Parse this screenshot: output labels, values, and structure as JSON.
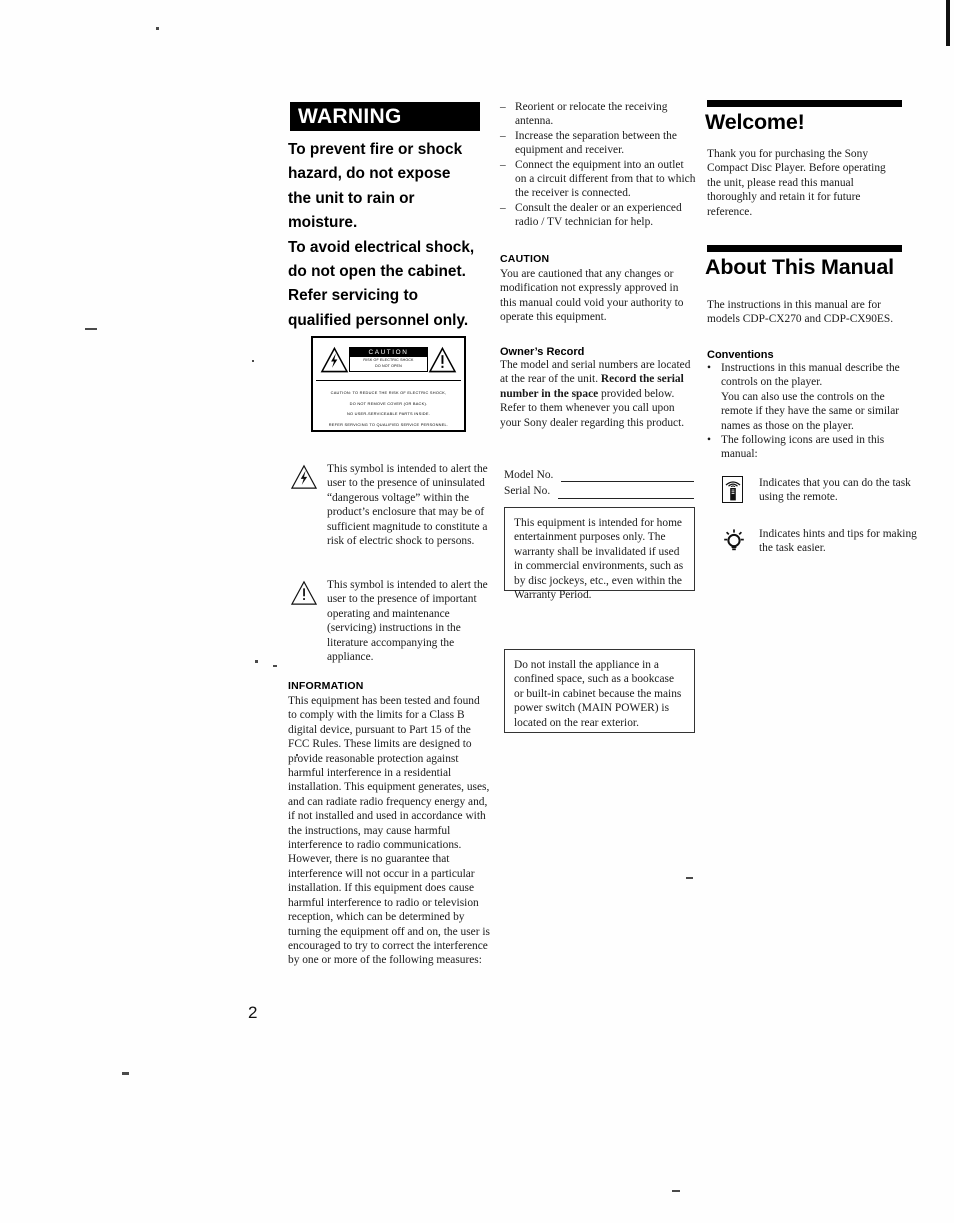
{
  "document": {
    "page_number": "2",
    "language": "en"
  },
  "column1": {
    "warning": {
      "title": "WARNING",
      "lines": [
        "To prevent fire or shock",
        "hazard, do not expose",
        "the unit to rain or",
        "moisture.",
        "To avoid electrical shock,",
        "do not open the cabinet.",
        "Refer servicing to",
        "qualified personnel only."
      ]
    },
    "label_graphic": {
      "caution_word": "CAUTION",
      "caution_sub_line1": "RISK OF ELECTRIC SHOCK",
      "caution_sub_line2": "DO NOT OPEN",
      "bottom_lines": [
        "CAUTION: TO REDUCE THE RISK OF ELECTRIC SHOCK,",
        "DO NOT REMOVE COVER (OR BACK).",
        "NO USER-SERVICEABLE PARTS INSIDE.",
        "REFER SERVICING TO QUALIFIED SERVICE PERSONNEL."
      ]
    },
    "symbol_lightning": {
      "icon": "lightning-bolt-triangle-icon",
      "text": "This symbol is intended to alert the user to the presence of uninsulated “dangerous voltage” within the product’s enclosure that may be of sufficient magnitude to constitute a risk of electric shock to persons."
    },
    "symbol_exclamation": {
      "icon": "exclamation-triangle-icon",
      "text": "This symbol is intended to alert the user to the presence of important operating and maintenance (servicing) instructions in the literature accompanying the appliance."
    },
    "information": {
      "heading": "INFORMATION",
      "text": "This equipment has been tested and found to comply with the limits for a Class B digital device, pursuant to Part 15 of the FCC Rules. These limits are designed to provide reasonable protection against harmful interference in a residential installation. This equipment generates, uses, and can radiate radio frequency energy and, if not installed and used in accordance with the instructions, may cause harmful interference to radio communications. However, there is no guarantee that interference will not occur in a particular installation. If this equipment does cause harmful interference to radio or television reception, which can be determined by turning the equipment off and on, the user is encouraged to try to correct the interference by one or more of the following measures:"
    }
  },
  "column2": {
    "remedies": [
      "Reorient or relocate the receiving antenna.",
      "Increase the separation between the equipment and receiver.",
      "Connect the equipment into an outlet on a circuit different from that to which the receiver is connected.",
      "Consult the dealer or an experienced radio / TV technician for help."
    ],
    "caution": {
      "heading": "CAUTION",
      "text": "You are cautioned that any changes or modification not expressly approved in this manual could void your authority to operate this equipment."
    },
    "owners_record": {
      "heading": "Owner’s Record",
      "text_part1": "The model and serial numbers are located at the rear of the unit.",
      "text_part2_bold": "Record the serial number in the space",
      "text_part3": " provided below. Refer to them whenever you call upon your Sony dealer regarding this product.",
      "model_label": "Model No.",
      "model_value": "",
      "serial_label": "Serial No.",
      "serial_value": ""
    },
    "note_box_1": "This equipment is intended for home entertainment purposes only. The warranty shall be invalidated if used in commercial environments, such as by disc jockeys, etc., even within the Warranty Period.",
    "note_box_2": "Do not install the appliance in a confined space, such as a bookcase or built-in cabinet because the mains power switch (MAIN POWER) is located on the rear exterior."
  },
  "column3": {
    "welcome": {
      "heading": "Welcome!",
      "text": "Thank you for purchasing the Sony Compact Disc Player. Before operating the unit, please read this manual thoroughly and retain it for future reference."
    },
    "about": {
      "heading": "About This Manual",
      "text": "The instructions in this manual are for models CDP-CX270 and CDP-CX90ES."
    },
    "conventions": {
      "heading": "Conventions",
      "bullets": [
        {
          "text": "Instructions in this manual describe the controls on the player.",
          "continuation": "You can also use the controls on the remote if they have the same or similar names as those on the player."
        },
        {
          "text": "The following icons are used in this manual:",
          "continuation": ""
        }
      ],
      "icons": [
        {
          "icon": "remote-control-icon",
          "text": "Indicates that you can do the task using the remote."
        },
        {
          "icon": "lightbulb-tip-icon",
          "text": "Indicates hints and tips for making the task easier."
        }
      ]
    }
  },
  "colors": {
    "ink": "#111111",
    "paper": "#fefefe",
    "bar": "#000000"
  }
}
